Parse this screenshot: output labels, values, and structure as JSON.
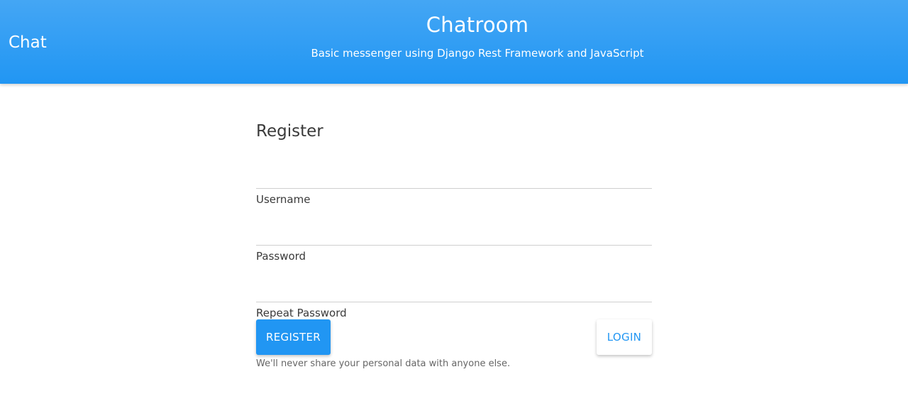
{
  "header": {
    "brand": "Chat",
    "title": "Chatroom",
    "subtitle": "Basic messenger using Django Rest Framework and JavaScript"
  },
  "form": {
    "heading": "Register",
    "fields": [
      {
        "label": "Username",
        "value": "",
        "placeholder": ""
      },
      {
        "label": "Password",
        "value": "",
        "placeholder": ""
      },
      {
        "label": "Repeat Password",
        "value": "",
        "placeholder": ""
      }
    ],
    "register_label": "REGISTER",
    "login_label": "LOGIN",
    "hint": "We'll never share your personal data with anyone else."
  },
  "colors": {
    "accent": "#2196f3",
    "header_top": "#44a6f4",
    "header_bottom": "#2196f3"
  }
}
